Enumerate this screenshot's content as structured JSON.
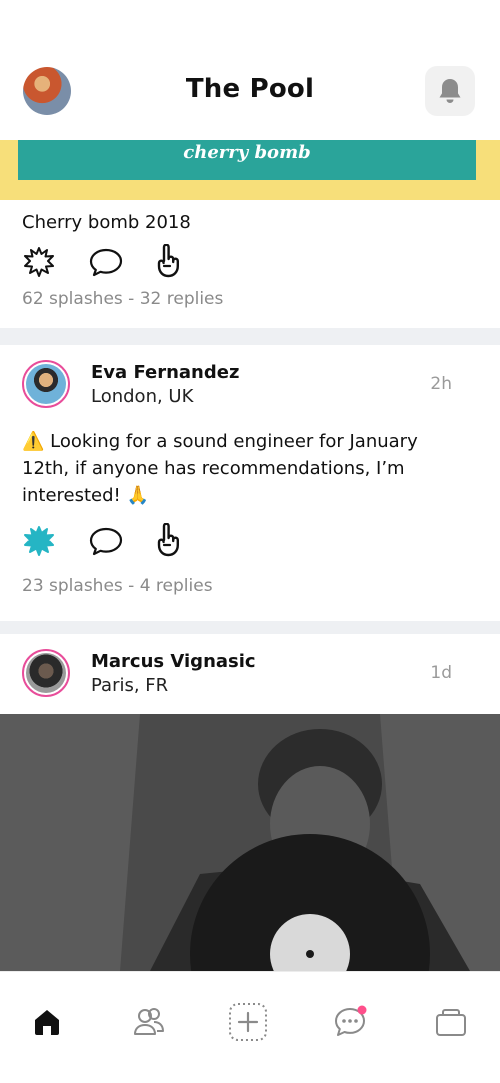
{
  "header": {
    "title": "The Pool",
    "avatar_icon": "profile-avatar",
    "notification_icon": "bell-icon"
  },
  "banner": {
    "text": "cherry bomb",
    "teal_color": "#2aa49a",
    "yellow_color": "#f7df7a"
  },
  "feed": {
    "post1": {
      "caption": "Cherry bomb 2018",
      "stats": "62 splashes - 32 replies",
      "splashed": false
    },
    "post2": {
      "author": "Eva Fernandez",
      "location": "London, UK",
      "time": "2h",
      "text": "⚠️ Looking for a sound engineer for January 12th, if anyone has recommendations, I’m interested! 🙏",
      "stats": "23 splashes - 4 replies",
      "splashed": true
    },
    "post3": {
      "author": "Marcus Vignasic",
      "location": "Paris, FR",
      "time": "1d"
    }
  },
  "nav": {
    "items": [
      "home-icon",
      "people-icon",
      "add-icon",
      "messages-icon",
      "portfolio-icon"
    ],
    "active": "home-icon",
    "badge_color": "#ff4f8b"
  },
  "colors": {
    "accent_pink": "#e84d9a",
    "splash_teal": "#25b5c4"
  }
}
